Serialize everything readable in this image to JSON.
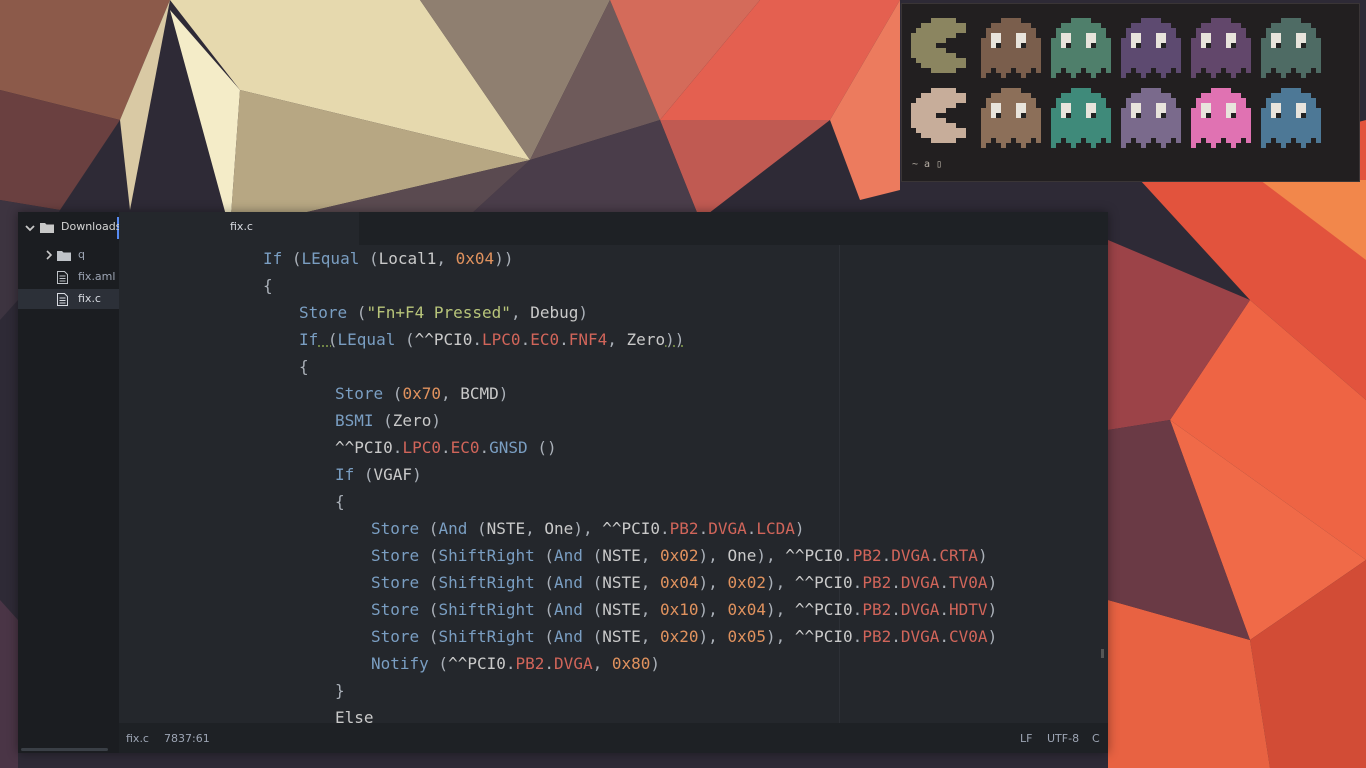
{
  "terminal": {
    "prompt": "~ a ▯",
    "sprites_row1": [
      {
        "kind": "pacman",
        "color": "#8b8560"
      },
      {
        "kind": "ghost",
        "color": "#7a5e4c"
      },
      {
        "kind": "ghost",
        "color": "#4f7f6b"
      },
      {
        "kind": "ghost",
        "color": "#5d4a70"
      },
      {
        "kind": "ghost",
        "color": "#62476b"
      },
      {
        "kind": "ghost",
        "color": "#4e6b64"
      }
    ],
    "sprites_row2": [
      {
        "kind": "pacman",
        "color": "#c7ad9a"
      },
      {
        "kind": "ghost",
        "color": "#8c6f59"
      },
      {
        "kind": "ghost",
        "color": "#3f8a7a"
      },
      {
        "kind": "ghost",
        "color": "#7a6a8c"
      },
      {
        "kind": "ghost",
        "color": "#e072b2"
      },
      {
        "kind": "ghost",
        "color": "#4d7896"
      }
    ]
  },
  "tree": {
    "root": "Downloads",
    "items": [
      {
        "label": "q",
        "icon": "folder-icon"
      },
      {
        "label": "fix.aml",
        "icon": "file-icon"
      },
      {
        "label": "fix.c",
        "icon": "file-icon"
      }
    ]
  },
  "tab": {
    "label": "fix.c"
  },
  "code_lines": [
    {
      "indent": 4,
      "tokens": [
        [
          "kw",
          "If"
        ],
        [
          "p",
          " ("
        ],
        [
          "kw",
          "LEqual"
        ],
        [
          "p",
          " ("
        ],
        [
          "id",
          "Local1"
        ],
        [
          "p",
          ", "
        ],
        [
          "num",
          "0x04"
        ],
        [
          "p",
          "))"
        ]
      ]
    },
    {
      "indent": 4,
      "tokens": [
        [
          "p",
          "{"
        ]
      ]
    },
    {
      "indent": 5,
      "tokens": [
        [
          "kw",
          "Store"
        ],
        [
          "p",
          " ("
        ],
        [
          "str",
          "\"Fn+F4 Pressed\""
        ],
        [
          "p",
          ", "
        ],
        [
          "id",
          "Debug"
        ],
        [
          "p",
          ")"
        ]
      ]
    },
    {
      "indent": 5,
      "tokens": [
        [
          "kw",
          "If"
        ],
        [
          "p",
          " ("
        ],
        [
          "kw",
          "LEqual"
        ],
        [
          "p",
          " ("
        ],
        [
          "id",
          "^^PCI0"
        ],
        [
          "p",
          "."
        ],
        [
          "path",
          "LPC0"
        ],
        [
          "p",
          "."
        ],
        [
          "path",
          "EC0"
        ],
        [
          "p",
          "."
        ],
        [
          "path",
          "FNF4"
        ],
        [
          "p",
          ", "
        ],
        [
          "id",
          "Zero"
        ],
        [
          "p",
          "))"
        ]
      ]
    },
    {
      "indent": 5,
      "tokens": [
        [
          "p",
          "{"
        ]
      ]
    },
    {
      "indent": 6,
      "tokens": [
        [
          "kw",
          "Store"
        ],
        [
          "p",
          " ("
        ],
        [
          "num",
          "0x70"
        ],
        [
          "p",
          ", "
        ],
        [
          "id",
          "BCMD"
        ],
        [
          "p",
          ")"
        ]
      ]
    },
    {
      "indent": 6,
      "tokens": [
        [
          "kw",
          "BSMI"
        ],
        [
          "p",
          " ("
        ],
        [
          "id",
          "Zero"
        ],
        [
          "p",
          ")"
        ]
      ]
    },
    {
      "indent": 6,
      "tokens": [
        [
          "id",
          "^^PCI0"
        ],
        [
          "p",
          "."
        ],
        [
          "path",
          "LPC0"
        ],
        [
          "p",
          "."
        ],
        [
          "path",
          "EC0"
        ],
        [
          "p",
          "."
        ],
        [
          "fn",
          "GNSD"
        ],
        [
          "p",
          " ()"
        ]
      ]
    },
    {
      "indent": 6,
      "tokens": [
        [
          "kw",
          "If"
        ],
        [
          "p",
          " ("
        ],
        [
          "id",
          "VGAF"
        ],
        [
          "p",
          ")"
        ]
      ]
    },
    {
      "indent": 6,
      "tokens": [
        [
          "p",
          "{"
        ]
      ]
    },
    {
      "indent": 7,
      "tokens": [
        [
          "kw",
          "Store"
        ],
        [
          "p",
          " ("
        ],
        [
          "kw",
          "And"
        ],
        [
          "p",
          " ("
        ],
        [
          "id",
          "NSTE"
        ],
        [
          "p",
          ", "
        ],
        [
          "id",
          "One"
        ],
        [
          "p",
          "), "
        ],
        [
          "id",
          "^^PCI0"
        ],
        [
          "p",
          "."
        ],
        [
          "path",
          "PB2"
        ],
        [
          "p",
          "."
        ],
        [
          "path",
          "DVGA"
        ],
        [
          "p",
          "."
        ],
        [
          "path",
          "LCDA"
        ],
        [
          "p",
          ")"
        ]
      ]
    },
    {
      "indent": 7,
      "tokens": [
        [
          "kw",
          "Store"
        ],
        [
          "p",
          " ("
        ],
        [
          "kw",
          "ShiftRight"
        ],
        [
          "p",
          " ("
        ],
        [
          "kw",
          "And"
        ],
        [
          "p",
          " ("
        ],
        [
          "id",
          "NSTE"
        ],
        [
          "p",
          ", "
        ],
        [
          "num",
          "0x02"
        ],
        [
          "p",
          "), "
        ],
        [
          "id",
          "One"
        ],
        [
          "p",
          "), "
        ],
        [
          "id",
          "^^PCI0"
        ],
        [
          "p",
          "."
        ],
        [
          "path",
          "PB2"
        ],
        [
          "p",
          "."
        ],
        [
          "path",
          "DVGA"
        ],
        [
          "p",
          "."
        ],
        [
          "path",
          "CRTA"
        ],
        [
          "p",
          ")"
        ]
      ]
    },
    {
      "indent": 7,
      "tokens": [
        [
          "kw",
          "Store"
        ],
        [
          "p",
          " ("
        ],
        [
          "kw",
          "ShiftRight"
        ],
        [
          "p",
          " ("
        ],
        [
          "kw",
          "And"
        ],
        [
          "p",
          " ("
        ],
        [
          "id",
          "NSTE"
        ],
        [
          "p",
          ", "
        ],
        [
          "num",
          "0x04"
        ],
        [
          "p",
          "), "
        ],
        [
          "num",
          "0x02"
        ],
        [
          "p",
          "), "
        ],
        [
          "id",
          "^^PCI0"
        ],
        [
          "p",
          "."
        ],
        [
          "path",
          "PB2"
        ],
        [
          "p",
          "."
        ],
        [
          "path",
          "DVGA"
        ],
        [
          "p",
          "."
        ],
        [
          "path",
          "TV0A"
        ],
        [
          "p",
          ")"
        ]
      ]
    },
    {
      "indent": 7,
      "tokens": [
        [
          "kw",
          "Store"
        ],
        [
          "p",
          " ("
        ],
        [
          "kw",
          "ShiftRight"
        ],
        [
          "p",
          " ("
        ],
        [
          "kw",
          "And"
        ],
        [
          "p",
          " ("
        ],
        [
          "id",
          "NSTE"
        ],
        [
          "p",
          ", "
        ],
        [
          "num",
          "0x10"
        ],
        [
          "p",
          "), "
        ],
        [
          "num",
          "0x04"
        ],
        [
          "p",
          "), "
        ],
        [
          "id",
          "^^PCI0"
        ],
        [
          "p",
          "."
        ],
        [
          "path",
          "PB2"
        ],
        [
          "p",
          "."
        ],
        [
          "path",
          "DVGA"
        ],
        [
          "p",
          "."
        ],
        [
          "path",
          "HDTV"
        ],
        [
          "p",
          ")"
        ]
      ]
    },
    {
      "indent": 7,
      "tokens": [
        [
          "kw",
          "Store"
        ],
        [
          "p",
          " ("
        ],
        [
          "kw",
          "ShiftRight"
        ],
        [
          "p",
          " ("
        ],
        [
          "kw",
          "And"
        ],
        [
          "p",
          " ("
        ],
        [
          "id",
          "NSTE"
        ],
        [
          "p",
          ", "
        ],
        [
          "num",
          "0x20"
        ],
        [
          "p",
          "), "
        ],
        [
          "num",
          "0x05"
        ],
        [
          "p",
          "), "
        ],
        [
          "id",
          "^^PCI0"
        ],
        [
          "p",
          "."
        ],
        [
          "path",
          "PB2"
        ],
        [
          "p",
          "."
        ],
        [
          "path",
          "DVGA"
        ],
        [
          "p",
          "."
        ],
        [
          "path",
          "CV0A"
        ],
        [
          "p",
          ")"
        ]
      ]
    },
    {
      "indent": 7,
      "tokens": [
        [
          "kw",
          "Notify"
        ],
        [
          "p",
          " ("
        ],
        [
          "id",
          "^^PCI0"
        ],
        [
          "p",
          "."
        ],
        [
          "path",
          "PB2"
        ],
        [
          "p",
          "."
        ],
        [
          "path",
          "DVGA"
        ],
        [
          "p",
          ", "
        ],
        [
          "num",
          "0x80"
        ],
        [
          "p",
          ")"
        ]
      ]
    },
    {
      "indent": 6,
      "tokens": [
        [
          "p",
          "}"
        ]
      ]
    },
    {
      "indent": 6,
      "tokens": [
        [
          "id",
          "Else"
        ]
      ]
    }
  ],
  "status": {
    "file": "fix.c",
    "cursor": "7837:61",
    "line_ending": "LF",
    "encoding": "UTF-8",
    "grammar": "C"
  },
  "colors": {
    "keyword": "#7a9ec2",
    "number": "#e0925e",
    "string": "#b8c57a",
    "path": "#d1655a",
    "accent": "#568af2"
  }
}
